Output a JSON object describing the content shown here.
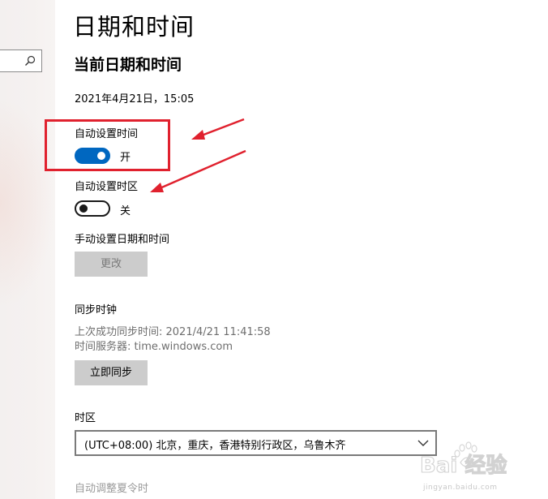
{
  "search": {
    "icon": "search-icon"
  },
  "page": {
    "title": "日期和时间",
    "section_title": "当前日期和时间",
    "current_datetime": "2021年4月21日，15:05"
  },
  "auto_time": {
    "label": "自动设置时间",
    "state": "开",
    "on": true
  },
  "auto_timezone": {
    "label": "自动设置时区",
    "state": "关",
    "on": false
  },
  "manual": {
    "label": "手动设置日期和时间",
    "button": "更改"
  },
  "sync": {
    "title": "同步时钟",
    "last_sync": "上次成功同步时间: 2021/4/21 11:41:58",
    "server": "时间服务器: time.windows.com",
    "button": "立即同步"
  },
  "timezone": {
    "label": "时区",
    "selected": "(UTC+08:00) 北京，重庆，香港特别行政区，乌鲁木齐"
  },
  "dst": {
    "label": "自动调整夏令时"
  },
  "watermark": {
    "text": "Bai 经验",
    "url": "jingyan.baidu.com"
  },
  "colors": {
    "toggle_on": "#0067c0",
    "annotation_red": "#e0212e",
    "button_gray": "#cccccc"
  }
}
